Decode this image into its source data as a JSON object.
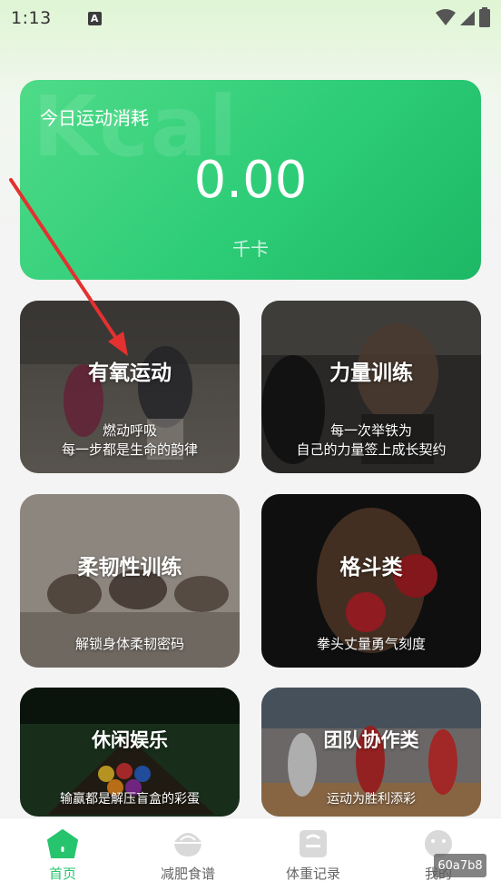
{
  "status_bar": {
    "time": "1:13",
    "notification_icon": "A"
  },
  "summary": {
    "watermark": "Kcal",
    "title": "今日运动消耗",
    "value": "0.00",
    "unit": "千卡"
  },
  "categories": [
    {
      "title": "有氧运动",
      "subtitle_line1": "燃动呼吸",
      "subtitle_line2": "每一步都是生命的韵律"
    },
    {
      "title": "力量训练",
      "subtitle_line1": "每一次举铁为",
      "subtitle_line2": "自己的力量签上成长契约"
    },
    {
      "title": "柔韧性训练",
      "subtitle_line1": "解锁身体柔韧密码"
    },
    {
      "title": "格斗类",
      "subtitle_line1": "拳头丈量勇气刻度"
    },
    {
      "title": "休闲娱乐",
      "subtitle_line1": "输赢都是解压盲盒的彩蛋"
    },
    {
      "title": "团队协作类",
      "subtitle_line1": "运动为胜利添彩"
    }
  ],
  "tabs": [
    {
      "label": "首页",
      "icon": "home-icon",
      "active": true
    },
    {
      "label": "减肥食谱",
      "icon": "bowl-icon",
      "active": false
    },
    {
      "label": "体重记录",
      "icon": "scale-icon",
      "active": false
    },
    {
      "label": "我的",
      "icon": "profile-icon",
      "active": false
    }
  ],
  "overlay_tag": "60a7b8",
  "colors": {
    "accent": "#27c46e",
    "card_start": "#4fdb88",
    "card_end": "#1db865"
  }
}
